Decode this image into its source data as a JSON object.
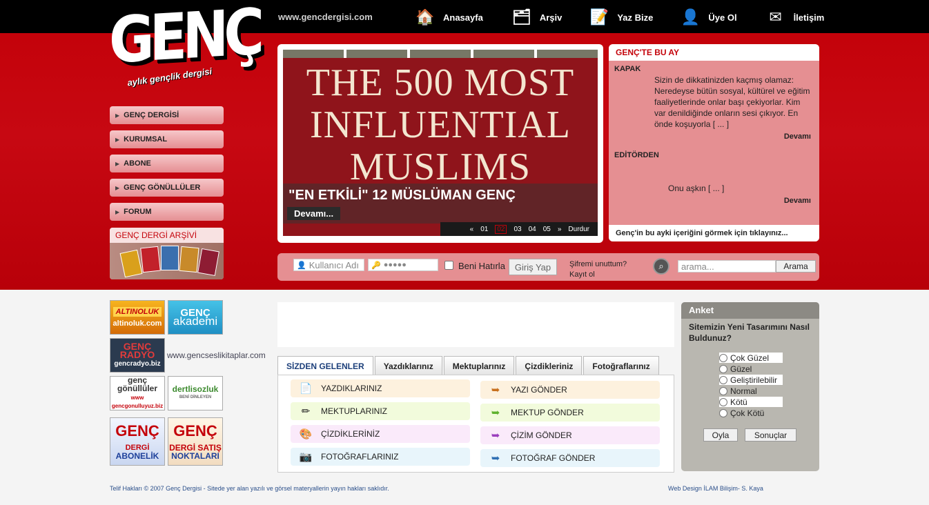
{
  "logo": {
    "main": "GENÇ",
    "sub": "aylık gençlik dergisi"
  },
  "site_url": "www.gencdergisi.com",
  "topnav": [
    {
      "label": "Anasayfa",
      "icon": "home-icon"
    },
    {
      "label": "Arşiv",
      "icon": "archive-icon"
    },
    {
      "label": "Yaz Bize",
      "icon": "write-icon"
    },
    {
      "label": "Üye Ol",
      "icon": "user-icon"
    },
    {
      "label": "İletişim",
      "icon": "mail-icon"
    }
  ],
  "leftmenu": [
    "GENÇ DERGİSİ",
    "KURUMSAL",
    "ABONE",
    "GENÇ GÖNÜLLÜLER",
    "FORUM"
  ],
  "archive": {
    "title": "GENÇ DERGİ ARŞİVİ"
  },
  "slider": {
    "image_text": "THE 500 MOST INFLUENTIAL MUSLIMS",
    "caption": "\"EN ETKİLİ\" 12 MÜSLÜMAN GENÇ",
    "more": "Devamı...",
    "pager": {
      "prev": "«",
      "pages": [
        "01",
        "02",
        "03",
        "04",
        "05"
      ],
      "current": "02",
      "next": "»",
      "stop": "Durdur"
    }
  },
  "this_month": {
    "title": "GENÇ'TE BU AY",
    "kapak_label": "KAPAK",
    "kapak_text": "Sizin de dikkatinizden kaçmış olamaz: Neredeyse bütün sosyal, kültürel ve eğitim faaliyetlerinde onlar başı çekiyorlar. Kim var denildiğinde onların sesi çıkıyor. En önde koşuyorla [ ... ]",
    "editor_label": "EDİTÖRDEN",
    "editor_text": "Onu aşkın  [ ... ]",
    "more": "Devamı",
    "footer": "Genç'in bu ayki içeriğini görmek için tıklayınız..."
  },
  "login": {
    "username_placeholder": "Kullanıcı Adı",
    "password_value": "●●●●●",
    "remember": "Beni Hatırla",
    "submit": "Giriş Yap",
    "forgot": "Şifremi unuttum?",
    "register": "Kayıt ol",
    "search_placeholder": "arama...",
    "search_button": "Arama"
  },
  "partners": {
    "altinoluk": {
      "top": "ALTINOLUK",
      "bottom": "altinoluk.com"
    },
    "akademi": {
      "top": "GENÇ",
      "bottom": "akademi"
    },
    "radyo": {
      "top": "GENÇ RADYO",
      "bottom": "gencradyo.biz"
    },
    "sesli_link": "www.gencseslikitaplar.com",
    "gonulluler": {
      "top": "genç gönüllüler",
      "bottom": "www gencgonulluyuz.biz"
    },
    "dertli": {
      "top": "dertlisozluk",
      "bottom": "BENİ DİNLEYEN"
    },
    "abonelik": {
      "top": "GENÇ",
      "mid": "DERGİ",
      "bottom": "ABONELİK"
    },
    "satis": {
      "top": "GENÇ",
      "mid": "DERGİ SATIŞ",
      "bottom": "NOKTALARI"
    }
  },
  "tabs": [
    "SİZDEN GELENLER",
    "Yazdıklarınız",
    "Mektuplarınız",
    "Çizdikleriniz",
    "Fotoğraflarınız"
  ],
  "panel": {
    "left": [
      {
        "label": "YAZDIKLARINIZ",
        "icon": "document-icon",
        "color": "#fdf1de"
      },
      {
        "label": "MEKTUPLARINIZ",
        "icon": "pen-icon",
        "color": "#f2fbdc"
      },
      {
        "label": "ÇİZDİKLERİNİZ",
        "icon": "palette-icon",
        "color": "#faeafa"
      },
      {
        "label": "FOTOĞRAFLARINIZ",
        "icon": "camera-icon",
        "color": "#e8f5fb"
      }
    ],
    "right": [
      {
        "label": "YAZI GÖNDER",
        "icon": "arrow-orange-icon",
        "color": "#fdf1de",
        "icon_color": "#c8701e"
      },
      {
        "label": "MEKTUP GÖNDER",
        "icon": "arrow-green-icon",
        "color": "#f2fbdc",
        "icon_color": "#5fb22e"
      },
      {
        "label": "ÇİZİM GÖNDER",
        "icon": "arrow-purple-icon",
        "color": "#faeafa",
        "icon_color": "#9b3fbd"
      },
      {
        "label": "FOTOĞRAF GÖNDER",
        "icon": "arrow-blue-icon",
        "color": "#e8f5fb",
        "icon_color": "#2f6fb3"
      }
    ]
  },
  "poll": {
    "title": "Anket",
    "question": "Sitemizin Yeni Tasarımını Nasıl Buldunuz?",
    "options": [
      "Çok Güzel",
      "Güzel",
      "Geliştirilebilir",
      "Normal",
      "Kötü",
      "Çok Kötü"
    ],
    "vote": "Oyla",
    "results": "Sonuçlar"
  },
  "footer": {
    "left": "Telif Hakları © 2007 Genç Dergisi - Sitede yer alan yazılı ve görsel materyallerin yayın hakları saklıdır.",
    "right": "Web Design İLAM Bilişim- S. Kaya"
  },
  "colors": {
    "brand_red": "#c4020a",
    "menu_pink": "#e58f92"
  }
}
